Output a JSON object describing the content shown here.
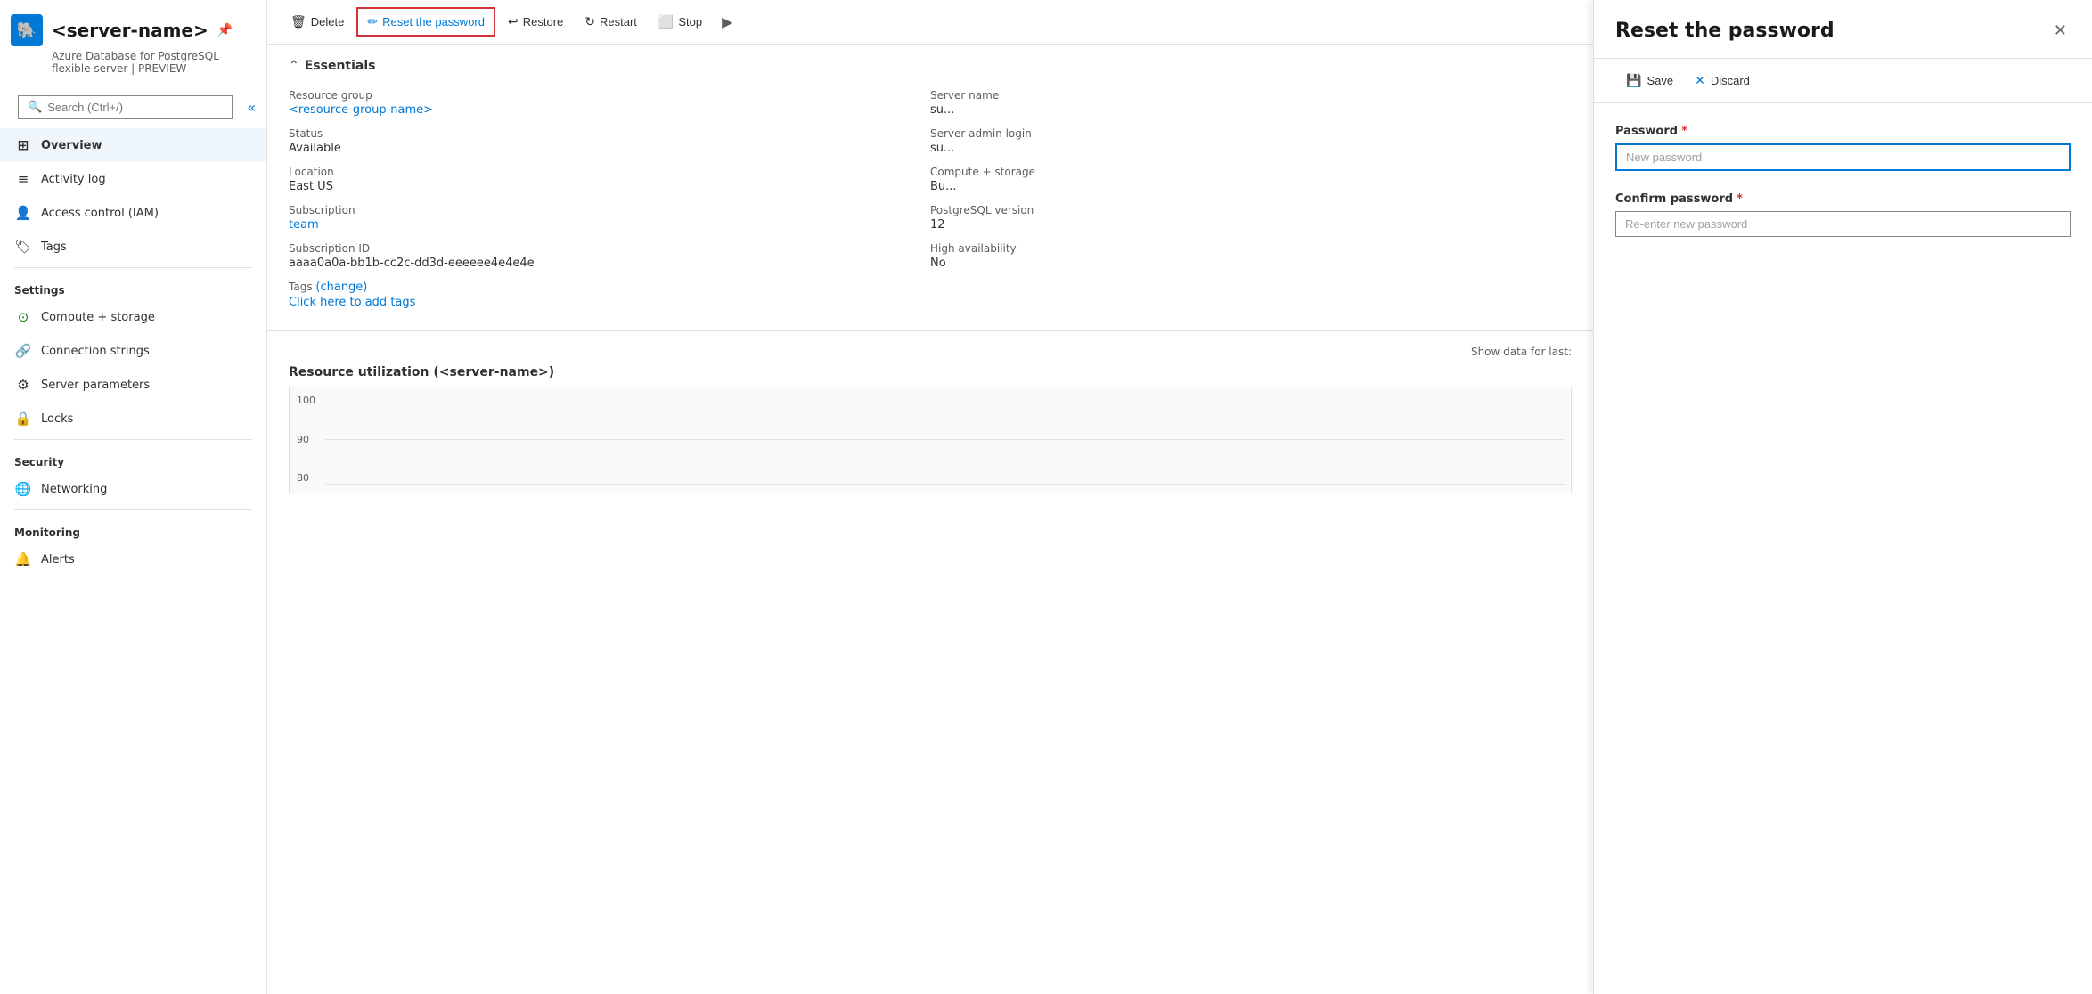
{
  "sidebar": {
    "server_name": "<server-name>",
    "subtitle": "Azure Database for PostgreSQL flexible server | PREVIEW",
    "search_placeholder": "Search (Ctrl+/)",
    "collapse_icon": "«",
    "server_icon": "🐘",
    "nav_items": [
      {
        "id": "overview",
        "label": "Overview",
        "icon": "⊞",
        "active": true
      },
      {
        "id": "activity-log",
        "label": "Activity log",
        "icon": "≡"
      },
      {
        "id": "access-control",
        "label": "Access control (IAM)",
        "icon": "👤"
      },
      {
        "id": "tags",
        "label": "Tags",
        "icon": "🏷"
      }
    ],
    "settings_section": "Settings",
    "settings_items": [
      {
        "id": "compute-storage",
        "label": "Compute + storage",
        "icon": "⚙"
      },
      {
        "id": "connection-strings",
        "label": "Connection strings",
        "icon": "🔗"
      },
      {
        "id": "server-parameters",
        "label": "Server parameters",
        "icon": "⚙"
      },
      {
        "id": "locks",
        "label": "Locks",
        "icon": "🔒"
      }
    ],
    "security_section": "Security",
    "security_items": [
      {
        "id": "networking",
        "label": "Networking",
        "icon": "🌐"
      }
    ],
    "monitoring_section": "Monitoring",
    "monitoring_items": [
      {
        "id": "alerts",
        "label": "Alerts",
        "icon": "🔔"
      }
    ]
  },
  "toolbar": {
    "delete_label": "Delete",
    "reset_password_label": "Reset the password",
    "restore_label": "Restore",
    "restart_label": "Restart",
    "stop_label": "Stop"
  },
  "essentials": {
    "title": "Essentials",
    "fields": [
      {
        "label": "Resource group",
        "value": "<resource-group-name>",
        "is_link": true
      },
      {
        "label": "Server name",
        "value": "su..."
      },
      {
        "label": "Status",
        "value": "Available"
      },
      {
        "label": "Server admin login",
        "value": "su..."
      },
      {
        "label": "Location",
        "value": "East US"
      },
      {
        "label": "Compute + storage",
        "value": "Bu..."
      },
      {
        "label": "Subscription",
        "value": "team",
        "is_link": true
      },
      {
        "label": "PostgreSQL version",
        "value": "12"
      },
      {
        "label": "Subscription ID",
        "value": "aaaa0a0a-bb1b-cc2c-dd3d-eeeeee4e4e4e"
      },
      {
        "label": "High availability",
        "value": "No"
      },
      {
        "label": "Tags",
        "value_parts": [
          "(change)",
          "Click here to add tags"
        ],
        "change_link": "(change)",
        "add_link": "Click here to add tags"
      }
    ]
  },
  "resource_utilization": {
    "title": "Resource utilization (<server-name>)",
    "show_data_label": "Show data for last:",
    "chart_labels": [
      "100",
      "90",
      "80"
    ]
  },
  "right_panel": {
    "title": "Reset the password",
    "save_label": "Save",
    "discard_label": "Discard",
    "password_label": "Password",
    "password_placeholder": "New password",
    "confirm_label": "Confirm password",
    "confirm_placeholder": "Re-enter new password"
  }
}
